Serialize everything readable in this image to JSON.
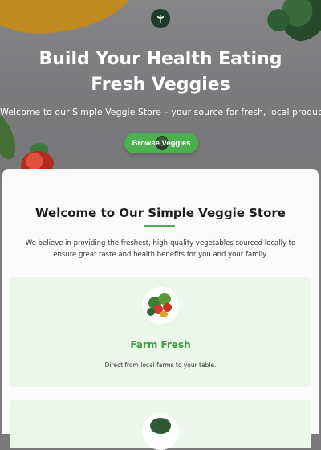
{
  "hero": {
    "title": "Build Your Health Eating Fresh Veggies",
    "subtitle": "Welcome to our Simple Veggie Store – your source for fresh, local produce!",
    "button_label": "Browse Veggies"
  },
  "logo_icon": "leaf-logo-icon",
  "about": {
    "title": "Welcome to Our Simple Veggie Store",
    "description": "We believe in providing the freshest, high-quality vegetables sourced locally to ensure great taste and health benefits for you and your family."
  },
  "features": [
    {
      "title": "Farm Fresh",
      "description": "Direct from local farms to your table.",
      "image_icon": "vegetable-basket-image"
    }
  ],
  "colors": {
    "accent": "#4caf50",
    "feature_title": "#3e9b43",
    "card_background": "#ebf7e8",
    "hero_overlay": "#7b7b7e"
  }
}
